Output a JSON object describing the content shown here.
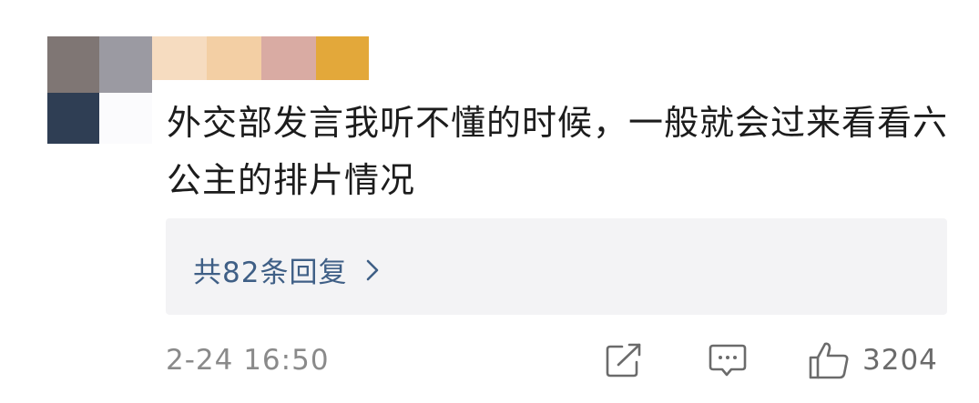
{
  "comment": {
    "text": "外交部发言我听不懂的时候，一般就会过来看看六公主的排片情况",
    "replies_label": "共82条回复",
    "timestamp": "2-24 16:50",
    "like_count": "3204"
  },
  "icons": {
    "share": "share-external-icon",
    "comment": "comment-bubble-icon",
    "like": "thumbs-up-icon",
    "reply_chevron": "chevron-right-icon"
  },
  "colors": {
    "text": "#1c1c1c",
    "link": "#3f5f86",
    "muted": "#8a8a8a",
    "reply_bg": "#f3f3f5"
  }
}
